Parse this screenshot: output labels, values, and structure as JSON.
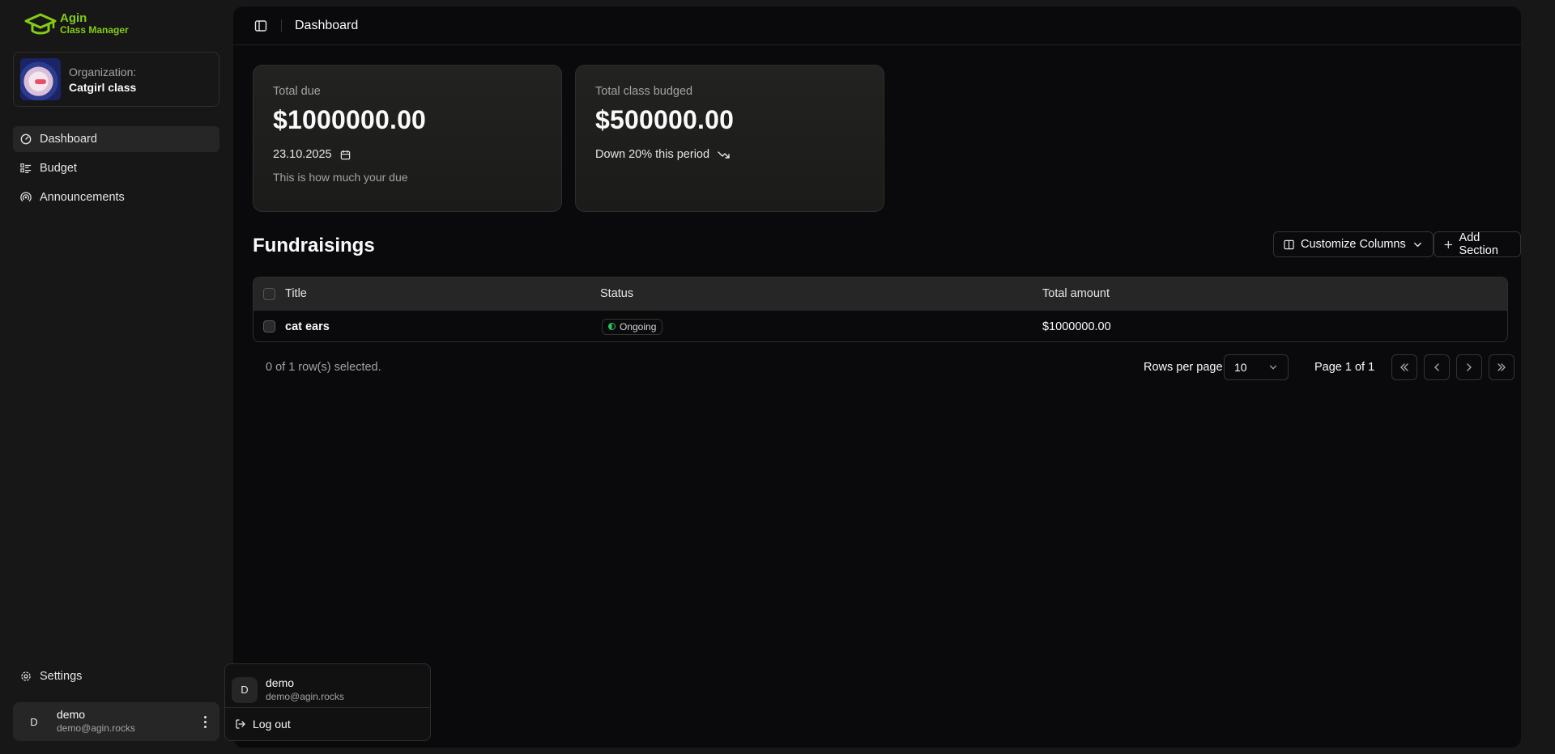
{
  "brand": {
    "line1": "Agin",
    "line2": "Class Manager",
    "accent": "#84cc16"
  },
  "org": {
    "label": "Organization:",
    "name": "Catgirl class"
  },
  "nav": [
    {
      "label": "Dashboard",
      "icon": "gauge-icon",
      "active": true
    },
    {
      "label": "Budget",
      "icon": "list-icon"
    },
    {
      "label": "Announcements",
      "icon": "broadcast-icon"
    }
  ],
  "settings": {
    "label": "Settings",
    "icon": "gear-icon"
  },
  "user": {
    "initial": "D",
    "name": "demo",
    "email": "demo@agin.rocks"
  },
  "popup": {
    "initial": "D",
    "name": "demo",
    "email": "demo@agin.rocks",
    "logout_label": "Log out"
  },
  "topbar": {
    "breadcrumb": "Dashboard"
  },
  "cards": {
    "due": {
      "label": "Total due",
      "value": "$1000000.00",
      "date": "23.10.2025",
      "sub": "This is how much your due"
    },
    "budget": {
      "label": "Total class budged",
      "value": "$500000.00",
      "trend": "Down 20% this period"
    }
  },
  "fundraisings": {
    "title": "Fundraisings",
    "customize_label": "Customize Columns",
    "add_label": "Add Section",
    "columns": {
      "title": "Title",
      "status": "Status",
      "amount": "Total amount"
    },
    "rows": [
      {
        "title": "cat ears",
        "status": "Ongoing",
        "amount": "$1000000.00"
      }
    ],
    "selection": "0 of 1 row(s) selected.",
    "rows_per_page_label": "Rows per page",
    "rows_per_page_value": "10",
    "page_info": "Page 1 of 1"
  }
}
